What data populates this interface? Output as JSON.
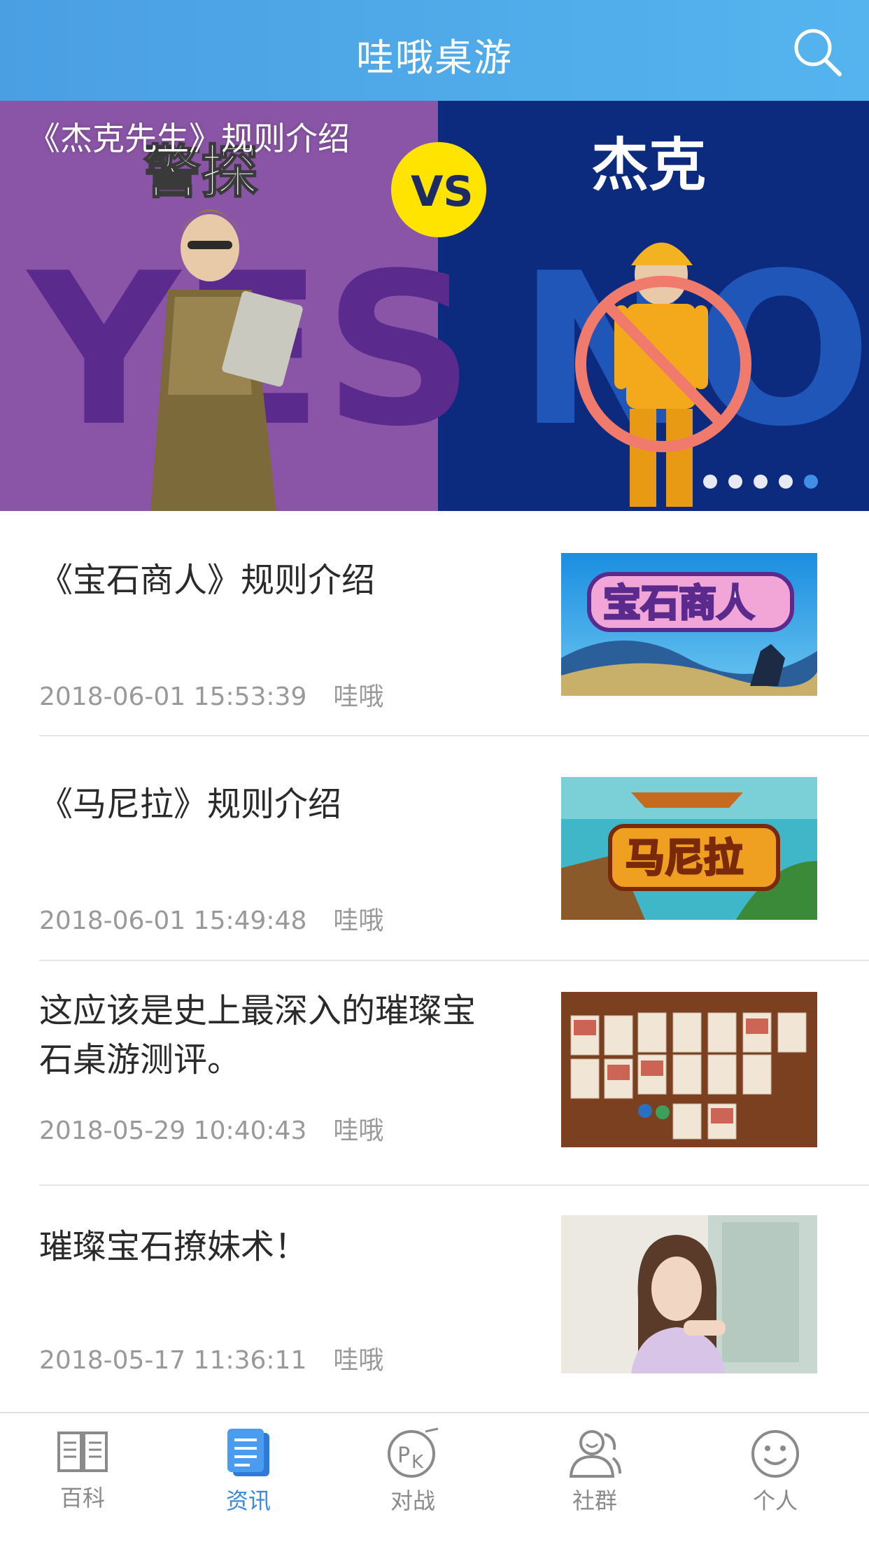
{
  "header": {
    "title": "哇哦桌游",
    "search_icon": "search-icon"
  },
  "banner": {
    "title": "《杰克先生》规则介绍",
    "left_heading": "警探",
    "right_heading": "杰克",
    "vs_text": "VS",
    "left_bg_word": "YES",
    "right_bg_word": "NO",
    "slide_count": 5,
    "active_slide": 5,
    "colors": {
      "left": "#8a55a6",
      "right": "#0c2a7e",
      "vs": "#ffe400"
    }
  },
  "news": [
    {
      "title": "《宝石商人》规则介绍",
      "time": "2018-06-01 15:53:39",
      "author": "哇哦",
      "thumb_text": "宝石商人"
    },
    {
      "title": "《马尼拉》规则介绍",
      "time": "2018-06-01 15:49:48",
      "author": "哇哦",
      "thumb_text": "马尼拉"
    },
    {
      "title": "这应该是史上最深入的璀璨宝石桌游测评。",
      "time": "2018-05-29 10:40:43",
      "author": "哇哦",
      "thumb_text": ""
    },
    {
      "title": "璀璨宝石撩妹术！",
      "time": "2018-05-17 11:36:11",
      "author": "哇哦",
      "thumb_text": ""
    }
  ],
  "tabbar": {
    "active": "资讯",
    "tabs": [
      {
        "label": "百科",
        "icon": "book-icon"
      },
      {
        "label": "资讯",
        "icon": "document-icon"
      },
      {
        "label": "对战",
        "icon": "pk-icon"
      },
      {
        "label": "社群",
        "icon": "people-icon"
      },
      {
        "label": "个人",
        "icon": "smiley-icon"
      }
    ]
  },
  "colors": {
    "accent": "#3a88e0",
    "header": "#4ea8e8",
    "muted": "#999999"
  }
}
